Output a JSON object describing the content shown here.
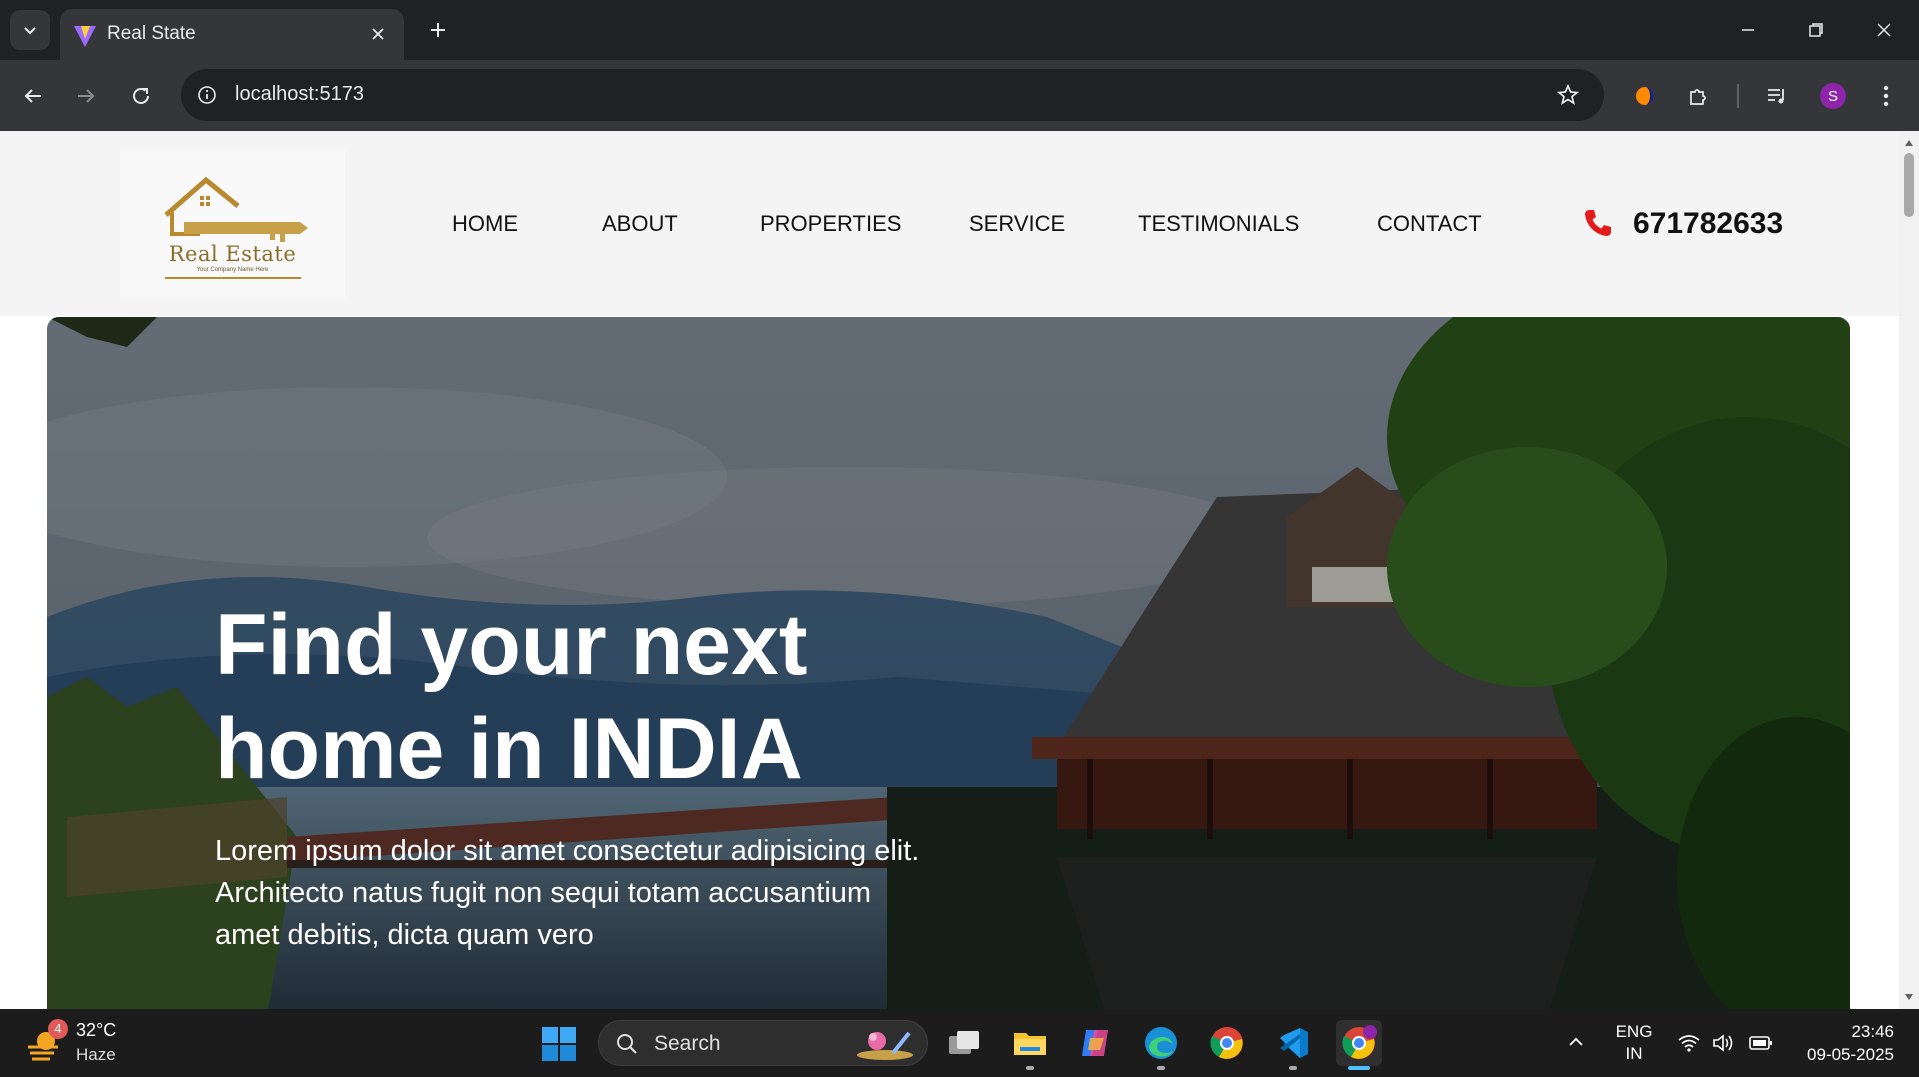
{
  "browser": {
    "tab_title": "Real State",
    "url": "localhost:5173",
    "profile_initial": "S"
  },
  "site": {
    "logo_text": "Real Estate",
    "logo_subtext": "Your Company Name Here",
    "nav": [
      {
        "label": "HOME"
      },
      {
        "label": "ABOUT"
      },
      {
        "label": "PROPERTIES"
      },
      {
        "label": "SERVICE"
      },
      {
        "label": "TESTIMONIALS"
      },
      {
        "label": "CONTACT"
      }
    ],
    "phone": "671782633",
    "accent_color": "#e31b1b"
  },
  "hero": {
    "title": "Find your next home in INDIA",
    "text": "Lorem ipsum dolor sit amet consectetur adipisicing elit. Architecto natus fugit non sequi totam accusantium amet debitis, dicta quam vero"
  },
  "taskbar": {
    "weather_badge": "4",
    "weather_temp": "32°C",
    "weather_desc": "Haze",
    "search_label": "Search",
    "lang_line1": "ENG",
    "lang_line2": "IN",
    "time": "23:46",
    "date": "09-05-2025",
    "apps": [
      "file-explorer-icon",
      "copilot-icon",
      "edge-icon",
      "chrome-icon",
      "vscode-icon",
      "chrome-profile-icon"
    ]
  }
}
